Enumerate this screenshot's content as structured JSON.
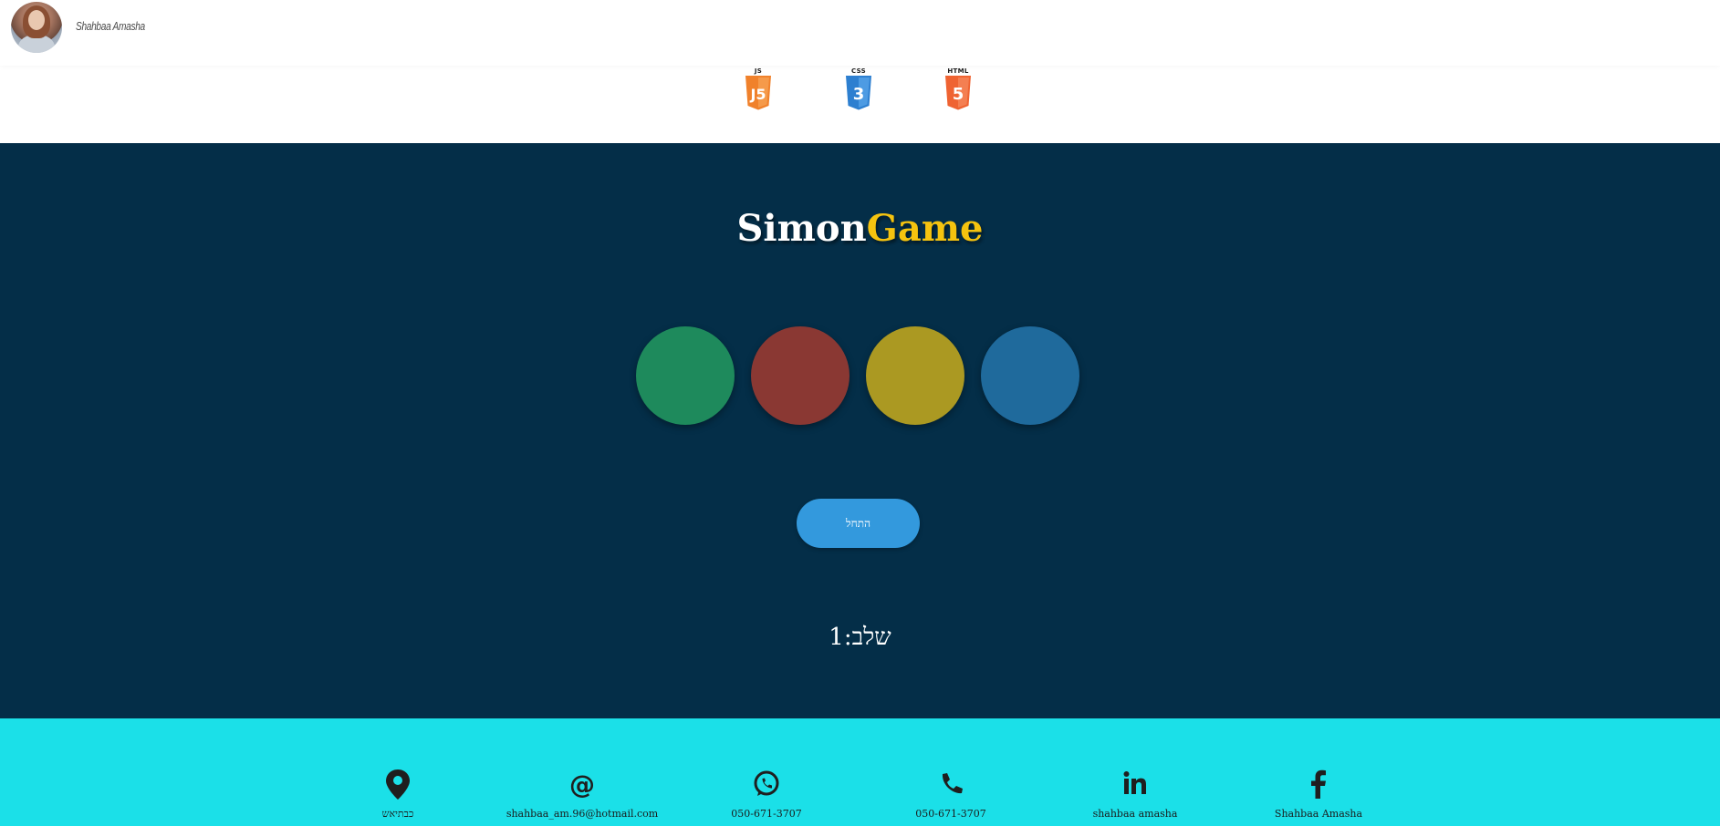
{
  "header": {
    "brand_name": "Shahbaa Amasha",
    "tech_icons": [
      {
        "caption": "JS",
        "label": "5",
        "color": "#f0812b",
        "icon": "js-icon"
      },
      {
        "caption": "CSS",
        "label": "3",
        "color": "#2d7fd0",
        "icon": "css3-icon"
      },
      {
        "caption": "HTML",
        "label": "5",
        "color": "#ef6332",
        "icon": "html5-icon"
      }
    ]
  },
  "game": {
    "title_part1": "Simon",
    "title_part2": "Game",
    "pads": [
      {
        "name": "green",
        "color": "#1e8a5c"
      },
      {
        "name": "red",
        "color": "#8a3833"
      },
      {
        "name": "yellow",
        "color": "#ab9922"
      },
      {
        "name": "blue",
        "color": "#1f6a9c"
      }
    ],
    "start_label": "התחל",
    "level_text": "שלב:1"
  },
  "footer": {
    "contacts": [
      {
        "icon": "location-pin-icon",
        "text": "כבתיאש"
      },
      {
        "icon": "at-email-icon",
        "text": "shahbaa_am.96@hotmail.com"
      },
      {
        "icon": "whatsapp-icon",
        "text": "050-671-3707"
      },
      {
        "icon": "phone-icon",
        "text": "050-671-3707"
      },
      {
        "icon": "linkedin-icon",
        "text": "shahbaa amasha"
      },
      {
        "icon": "facebook-icon",
        "text": "Shahbaa Amasha"
      }
    ]
  }
}
